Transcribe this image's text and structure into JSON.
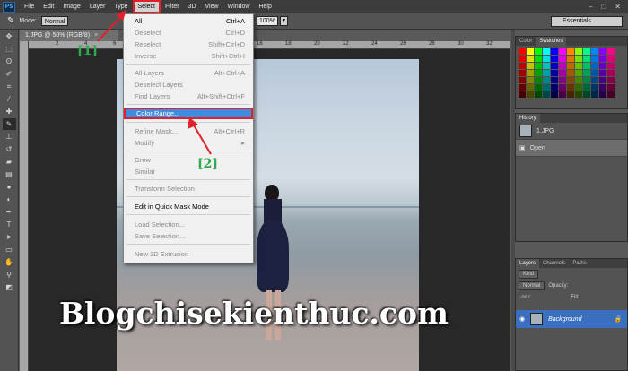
{
  "menubar": {
    "logo": "Ps",
    "items": [
      "File",
      "Edit",
      "Image",
      "Layer",
      "Type",
      "Select",
      "Filter",
      "3D",
      "View",
      "Window",
      "Help"
    ],
    "active": "Select",
    "window_controls": [
      "‒",
      "□",
      "✕"
    ]
  },
  "options_bar": {
    "tool_icon": "brush-icon",
    "mode_label": "Mode:",
    "mode_value": "Normal",
    "zoom_value": "100%",
    "workspace": "Essentials"
  },
  "document": {
    "tab_title": "1.JPG @ 50% (RGB/8)",
    "tab_close": "×",
    "ruler_ticks": [
      "2",
      "4",
      "6",
      "8",
      "10",
      "12",
      "14",
      "16",
      "18",
      "20",
      "22",
      "24",
      "26",
      "28",
      "30",
      "32"
    ]
  },
  "select_menu": {
    "items": [
      {
        "label": "All",
        "shortcut": "Ctrl+A",
        "enabled": true
      },
      {
        "label": "Deselect",
        "shortcut": "Ctrl+D",
        "enabled": false
      },
      {
        "label": "Reselect",
        "shortcut": "Shift+Ctrl+D",
        "enabled": false
      },
      {
        "label": "Inverse",
        "shortcut": "Shift+Ctrl+I",
        "enabled": false
      },
      {
        "label": "All Layers",
        "shortcut": "Alt+Ctrl+A",
        "enabled": false
      },
      {
        "label": "Deselect Layers",
        "shortcut": "",
        "enabled": false
      },
      {
        "label": "Find Layers",
        "shortcut": "Alt+Shift+Ctrl+F",
        "enabled": false
      },
      {
        "label": "Color Range...",
        "shortcut": "",
        "enabled": true,
        "highlighted": true
      },
      {
        "label": "Refine Mask...",
        "shortcut": "Alt+Ctrl+R",
        "enabled": false
      },
      {
        "label": "Modify",
        "shortcut": "▸",
        "enabled": false
      },
      {
        "label": "Grow",
        "shortcut": "",
        "enabled": false
      },
      {
        "label": "Similar",
        "shortcut": "",
        "enabled": false
      },
      {
        "label": "Transform Selection",
        "shortcut": "",
        "enabled": false
      },
      {
        "label": "Edit in Quick Mask Mode",
        "shortcut": "",
        "enabled": true
      },
      {
        "label": "Load Selection...",
        "shortcut": "",
        "enabled": false
      },
      {
        "label": "Save Selection...",
        "shortcut": "",
        "enabled": false
      },
      {
        "label": "New 3D Extrusion",
        "shortcut": "",
        "enabled": false
      }
    ]
  },
  "annotations": {
    "step1": "[1]",
    "step2": "[2]",
    "color": "#2fa84f",
    "arrow_color": "#e0202a"
  },
  "watermark": "Blogchisekienthuc.com",
  "panels": {
    "color_tabs": [
      "Color",
      "Swatches"
    ],
    "history_tab": "History",
    "history_items": [
      {
        "label": "1.JPG"
      },
      {
        "label": "Open"
      }
    ],
    "layers_tabs": [
      "Layers",
      "Channels",
      "Paths"
    ],
    "layers_kind": "Kind",
    "blend_mode": "Normal",
    "opacity_label": "Opacity:",
    "lock_label": "Lock:",
    "fill_label": "Fill:",
    "layer_name": "Background"
  }
}
